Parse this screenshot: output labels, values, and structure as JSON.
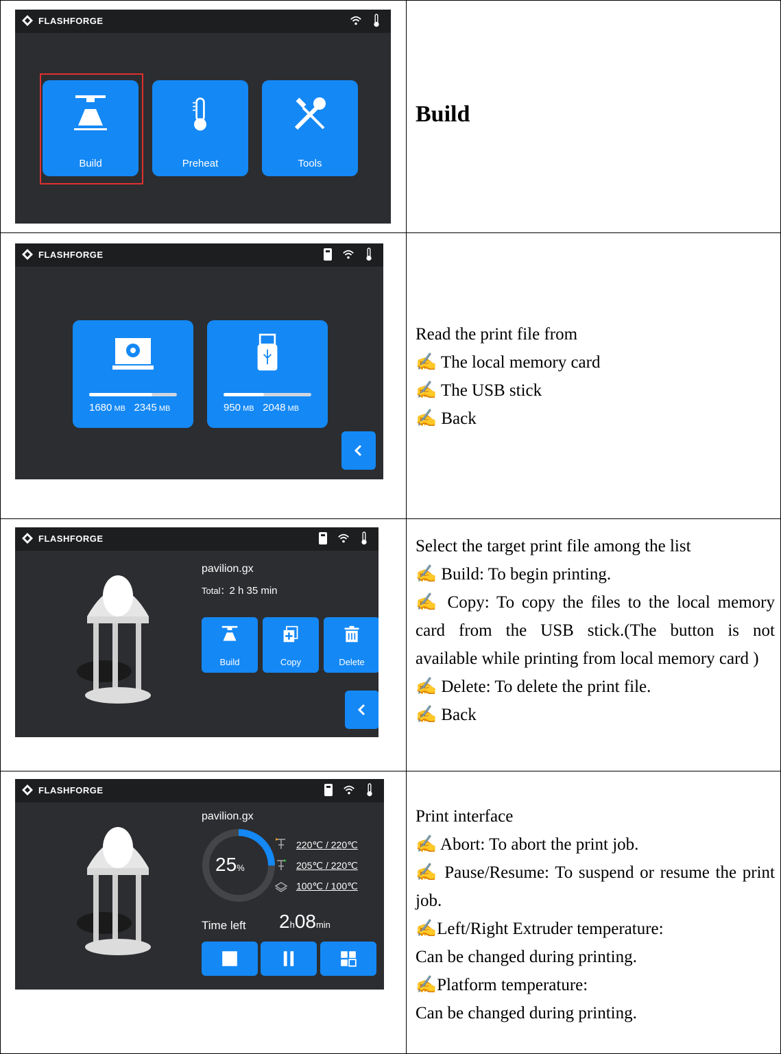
{
  "brand": "FLASHFORGE",
  "row1": {
    "tiles": [
      "Build",
      "Preheat",
      "Tools"
    ],
    "heading": "Build"
  },
  "row2": {
    "local": {
      "used": "1680",
      "total": "2345",
      "unit": "MB",
      "fraction": 0.72
    },
    "usb": {
      "used": "950",
      "total": "2048",
      "unit": "MB",
      "fraction": 0.46
    },
    "desc": [
      "Read the print file from",
      "✍ The local memory card",
      "✍ The USB stick",
      "✍ Back"
    ]
  },
  "row3": {
    "filename": "pavilion.gx",
    "total_label": "Total：",
    "total_value": "2 h 35 min",
    "buttons": [
      "Build",
      "Copy",
      "Delete"
    ],
    "desc_title": "Select the target print file among the list",
    "desc_build": "✍ Build: To begin printing.",
    "desc_copy": "✍ Copy: To copy the files to the local memory card from the USB stick.(The button is not available while printing from local memory card )",
    "desc_delete": "✍ Delete: To delete the print file.",
    "desc_back": "✍ Back"
  },
  "row4": {
    "filename": "pavilion.gx",
    "progress": "25",
    "progress_unit": "%",
    "progress_fraction": 0.25,
    "temps": [
      "220℃ / 220℃",
      "205℃ / 220℃",
      "100℃ / 100℃"
    ],
    "time_label": "Time left",
    "time_h": "2",
    "time_h_unit": "h",
    "time_m": "08",
    "time_m_unit": "min",
    "desc": [
      "Print interface",
      "✍ Abort: To abort the print job.",
      "✍ Pause/Resume: To suspend or resume the print job.",
      "✍Left/Right Extruder temperature:",
      "Can be changed during printing.",
      "✍Platform temperature:",
      "Can be changed during printing."
    ]
  },
  "colors": {
    "accent": "#1488f5",
    "screen_bg": "#2c2d30",
    "topbar": "#1d1e20",
    "highlight": "#e03030"
  }
}
